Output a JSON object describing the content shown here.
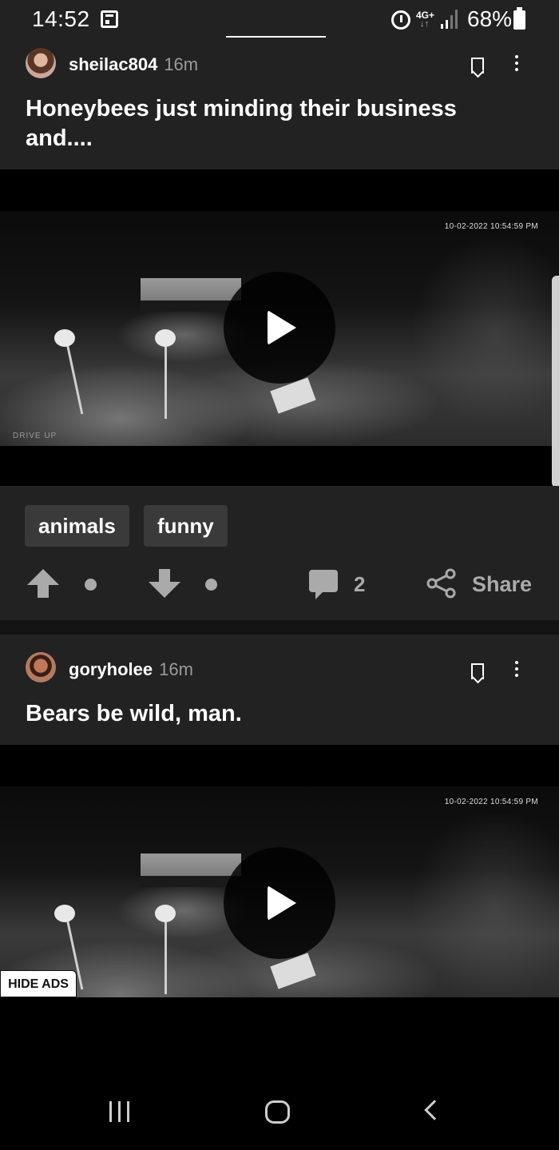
{
  "status_bar": {
    "time": "14:52",
    "network": "4G+",
    "network_arrows": "↓↑",
    "battery": "68%",
    "icons": [
      "calendar-icon",
      "alarm-icon",
      "signal-icon",
      "battery-icon"
    ]
  },
  "posts": [
    {
      "username": "sheilac804",
      "time_ago": "16m",
      "title": "Honeybees just minding their business and....",
      "video": {
        "timestamp": "10-02-2022 10:54:59 PM",
        "camera_label": "DRIVE UP"
      },
      "tags": [
        "animals",
        "funny"
      ],
      "actions": {
        "upvotes_label": "",
        "downvotes_label": "",
        "comment_count": "2",
        "share_label": "Share"
      }
    },
    {
      "username": "goryholee",
      "time_ago": "16m",
      "title": "Bears be wild, man.",
      "video": {
        "timestamp": "10-02-2022 10:54:59 PM"
      }
    }
  ],
  "ads": {
    "hide_label": "HIDE ADS"
  },
  "nav_bar": {
    "icons": [
      "recents-icon",
      "home-icon",
      "back-icon"
    ]
  },
  "colors": {
    "card_bg": "#222222",
    "page_bg": "#111111",
    "muted": "#aaaaaa",
    "tag_bg": "#3a3a3a"
  }
}
